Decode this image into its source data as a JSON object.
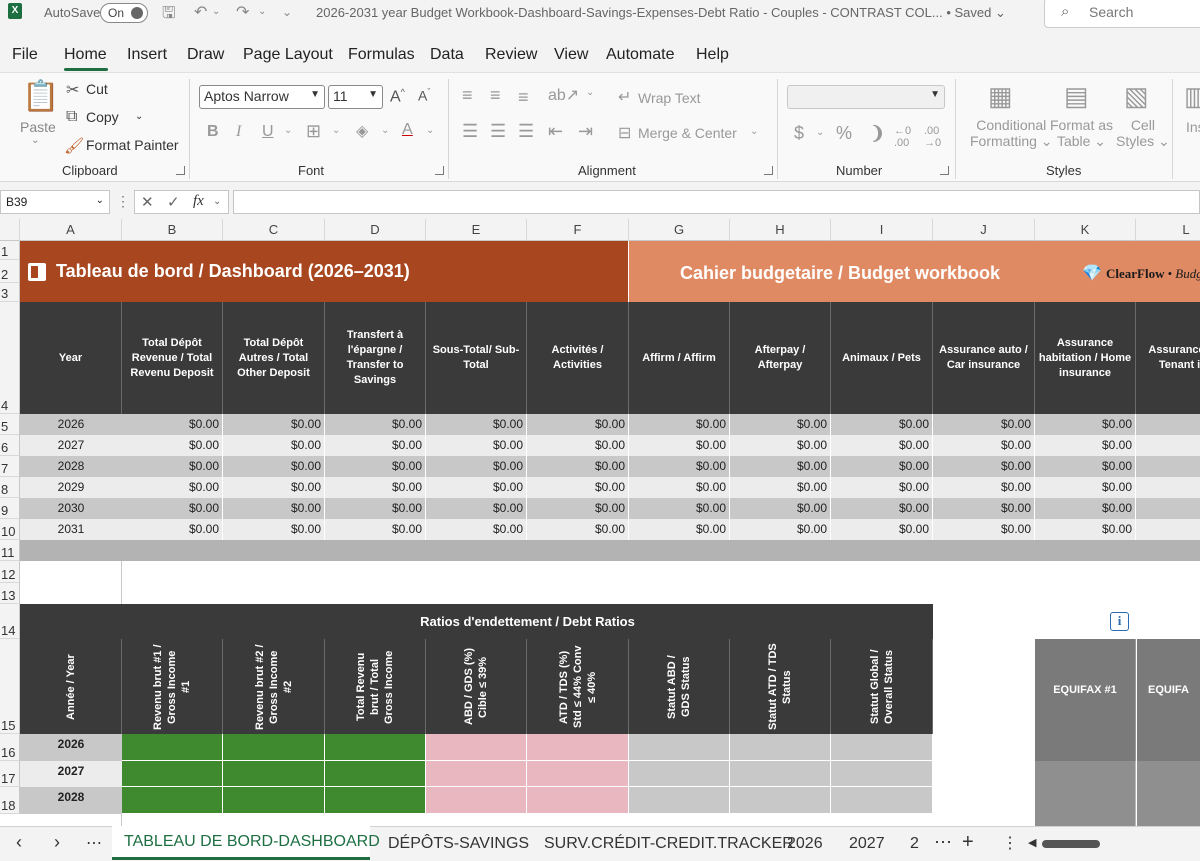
{
  "titlebar": {
    "autosave_label": "AutoSave",
    "autosave_state": "On",
    "doc_title": "2026-2031 year Budget Workbook-Dashboard-Savings-Expenses-Debt Ratio - Couples - CONTRAST COL...",
    "saved_status": "• Saved",
    "search_placeholder": "Search"
  },
  "menu": [
    "File",
    "Home",
    "Insert",
    "Draw",
    "Page Layout",
    "Formulas",
    "Data",
    "Review",
    "View",
    "Automate",
    "Help"
  ],
  "ribbon": {
    "clipboard": {
      "paste": "Paste",
      "cut": "Cut",
      "copy": "Copy",
      "format_painter": "Format Painter",
      "label": "Clipboard"
    },
    "font": {
      "name": "Aptos Narrow",
      "size": "11",
      "bold": "B",
      "italic": "I",
      "underline": "U",
      "label": "Font"
    },
    "alignment": {
      "wrap": "Wrap Text",
      "merge": "Merge & Center",
      "label": "Alignment"
    },
    "number": {
      "currency": "$",
      "percent": "%",
      "comma": "❩",
      "label": "Number"
    },
    "styles": {
      "conditional1": "Conditional",
      "conditional2": "Formatting",
      "table1": "Format as",
      "table2": "Table",
      "cell1": "Cell",
      "cell2": "Styles",
      "label": "Styles"
    },
    "insert_cut": "Ins"
  },
  "formula_bar": {
    "name_box": "B39",
    "fx": "fx",
    "value": ""
  },
  "columns": [
    "A",
    "B",
    "C",
    "D",
    "E",
    "F",
    "G",
    "H",
    "I",
    "J",
    "K",
    "L"
  ],
  "rows": [
    "1",
    "2",
    "3",
    "4",
    "5",
    "6",
    "7",
    "8",
    "9",
    "10",
    "11",
    "12",
    "13",
    "14",
    "15",
    "16",
    "17",
    "18"
  ],
  "banner": {
    "left_title": "Tableau de bord / Dashboard  (2026–2031)",
    "right_title": "Cahier budgetaire  / Budget workbook",
    "brand": "ClearFlow",
    "brand_suffix": "• Budg"
  },
  "table1": {
    "headers": [
      "Year",
      "Total Dépôt Revenue / Total Revenu Deposit",
      "Total Dépôt Autres / Total Other Deposit",
      "Transfert à l'épargne / Transfer to Savings",
      "Sous-Total/ Sub-Total",
      "Activités / Activities",
      "Affirm / Affirm",
      "Afterpay / Afterpay",
      "Animaux / Pets",
      "Assurance auto / Car insurance",
      "Assurance habitation / Home insurance",
      "Assurance lo / Tenant ins"
    ],
    "years": [
      "2026",
      "2027",
      "2028",
      "2029",
      "2030",
      "2031"
    ],
    "value": "$0.00"
  },
  "table2": {
    "title": "Ratios d'endettement / Debt Ratios",
    "headers": [
      "Année / Year",
      "Revenu brut #1 / Gross Income #1",
      "Revenu brut #2 / Gross Income #2",
      "Total Revenu brut / Total Gross Income",
      "ABD / GDS (%) Cible ≤ 39%",
      "ATD / TDS (%) Std ≤ 44% Conv ≤ 40%",
      "Statut ABD / GDS Status",
      "Statut ATD / TDS Status",
      "Statut Global / Overall Status"
    ],
    "years": [
      "2026",
      "2027",
      "2028"
    ],
    "equifax1": "EQUIFAX #1",
    "equifax2": "EQUIFA",
    "info_icon": "i"
  },
  "sheet_tabs": [
    "TABLEAU DE BORD-DASHBOARD",
    "DÉPÔTS-SAVINGS",
    "SURV.CRÉDIT-CREDIT.TRACKER",
    "2026",
    "2027",
    "2"
  ],
  "colors": {
    "accent": "#1d6f42",
    "banner_dark": "#a8471f",
    "banner_light": "#e08a64",
    "header_dark": "#3a3a3a",
    "green_cell": "#3f8a2f",
    "pink_cell": "#e8b7bf"
  }
}
